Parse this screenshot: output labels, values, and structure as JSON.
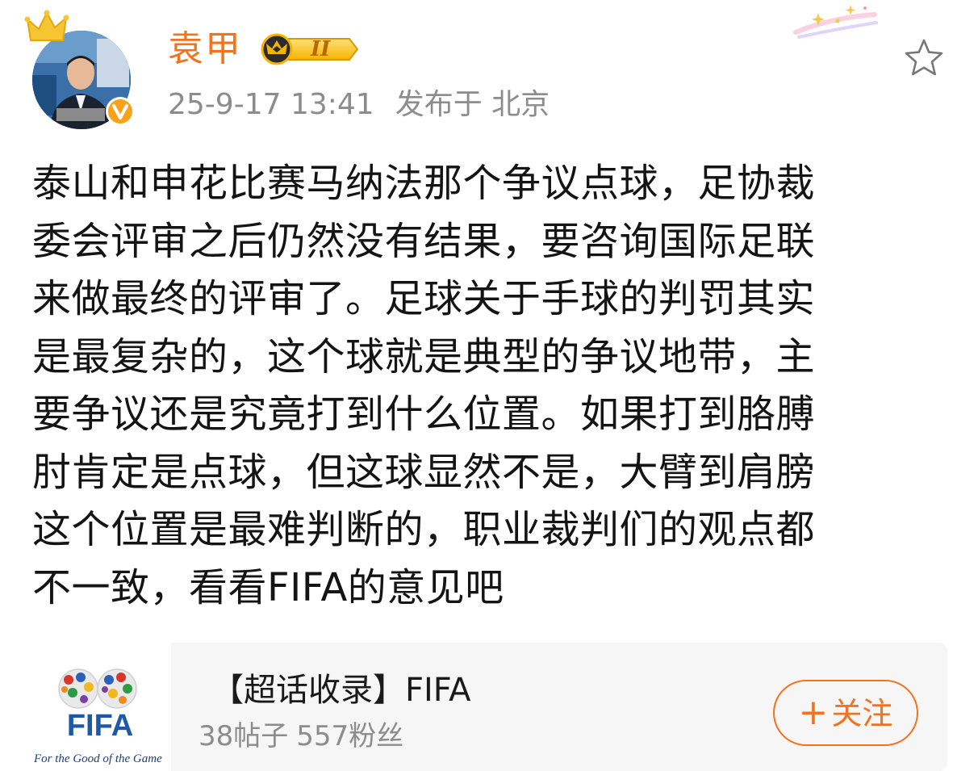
{
  "post": {
    "author": {
      "name": "袁甲",
      "level": "II",
      "verified": true
    },
    "timestamp": "25-9-17 13:41",
    "location": "发布于 北京",
    "text_lines": [
      "泰山和申花比赛马纳法那个争议点球，足协裁",
      "委会评审之后仍然没有结果，要咨询国际足联",
      "来做最终的评审了。足球关于手球的判罚其实",
      "是最复杂的，这个球就是典型的争议地带，主",
      "要争议还是究竟打到什么位置。如果打到胳膊",
      "肘肯定是点球，但这球显然不是，大臂到肩膀",
      "这个位置是最难判断的，职业裁判们的观点都",
      "不一致，看看FIFA的意见吧"
    ]
  },
  "topic_card": {
    "title": "【超话收录】FIFA",
    "posts": "38帖子",
    "fans": "557粉丝",
    "follow_label": "关注",
    "follow_plus": "+",
    "logo_text": "FIFA",
    "logo_tagline": "For the Good of the Game"
  },
  "colors": {
    "accent": "#f0731f",
    "meta_gray": "#8c8c8c",
    "card_bg": "#f6f6f6",
    "level_gold": "#f5b400"
  },
  "icons": {
    "favorite": "star-outline-icon",
    "verified": "verified-badge-icon",
    "crown": "crown-icon"
  }
}
